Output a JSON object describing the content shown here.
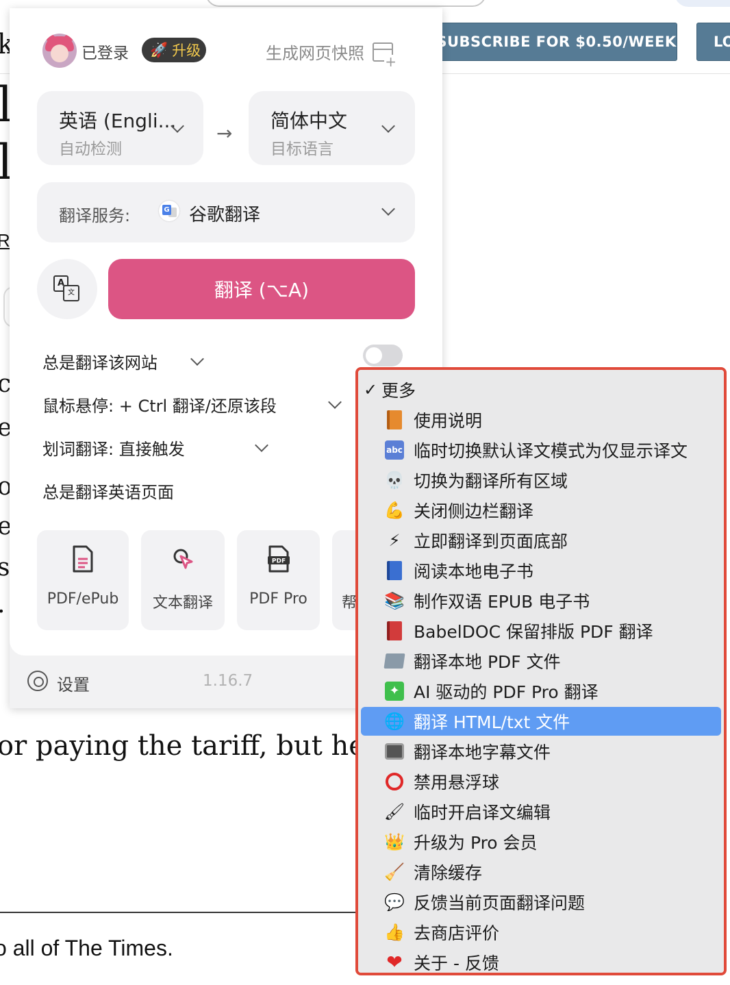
{
  "background_page": {
    "subscribe_label": "SUBSCRIBE FOR $0.50/WEEK",
    "login_label": "LO",
    "frag_top": "k",
    "frag_big1": "l",
    "frag_big2": "l",
    "frag_r": "R",
    "frag_lines": [
      "c",
      "e",
      "o",
      "e",
      "s",
      "."
    ],
    "article_line": "or paying the tariff, but here’s",
    "bottom_text": "o all of The Times."
  },
  "popup": {
    "status": "已登录",
    "upgrade": "升级",
    "snapshot": "生成网页快照",
    "source_lang": {
      "main": "英语 (Engli...",
      "sub": "自动检测"
    },
    "target_lang": {
      "main": "简体中文",
      "sub": "目标语言"
    },
    "arrow": "→",
    "service_label": "翻译服务:",
    "service_name": "谷歌翻译",
    "translate_button": "翻译 (⌥A)",
    "options": {
      "always_site": "总是翻译该网站",
      "hover": "鼠标悬停:  + Ctrl 翻译/还原该段",
      "selection": "划词翻译:  直接触发",
      "always_lang": "总是翻译英语页面"
    },
    "always_site_enabled": false,
    "tools": [
      "PDF/ePub",
      "文本翻译",
      "PDF Pro",
      "帮"
    ],
    "settings": "设置",
    "version": "1.16.7"
  },
  "menu": {
    "header": "更多",
    "selected_index": 11,
    "items": [
      {
        "icon": "orange-book-icon",
        "label": "使用说明"
      },
      {
        "icon": "abc-icon",
        "label": "临时切换默认译文模式为仅显示译文"
      },
      {
        "icon": "skull-icon",
        "label": "切换为翻译所有区域"
      },
      {
        "icon": "flexed-biceps-icon",
        "label": "关闭侧边栏翻译"
      },
      {
        "icon": "lightning-icon",
        "label": "立即翻译到页面底部"
      },
      {
        "icon": "blue-book-icon",
        "label": "阅读本地电子书"
      },
      {
        "icon": "books-icon",
        "label": "制作双语 EPUB 电子书"
      },
      {
        "icon": "red-book-icon",
        "label": "BabelDOC 保留排版 PDF 翻译"
      },
      {
        "icon": "folder-icon",
        "label": "翻译本地 PDF 文件"
      },
      {
        "icon": "sparkle-icon",
        "label": "AI 驱动的 PDF Pro 翻译"
      },
      {
        "icon": "globe-icon",
        "label": "翻译 HTML/txt 文件"
      },
      {
        "icon": "television-icon",
        "label": "翻译本地字幕文件"
      },
      {
        "icon": "red-circle-icon",
        "label": "禁用悬浮球"
      },
      {
        "icon": "paintbrush-icon",
        "label": "临时开启译文编辑"
      },
      {
        "icon": "crown-icon",
        "label": "升级为 Pro 会员"
      },
      {
        "icon": "broom-icon",
        "label": "清除缓存"
      },
      {
        "icon": "speech-bubble-icon",
        "label": "反馈当前页面翻译问题"
      },
      {
        "icon": "thumbs-up-icon",
        "label": "去商店评价"
      },
      {
        "icon": "heart-icon",
        "label": "关于 - 反馈"
      }
    ]
  },
  "colors": {
    "accent_pink": "#dc5584",
    "menu_selected": "#5f9cf3",
    "highlight_outline": "#e04a3a",
    "subscribe_bg": "#567b95"
  }
}
